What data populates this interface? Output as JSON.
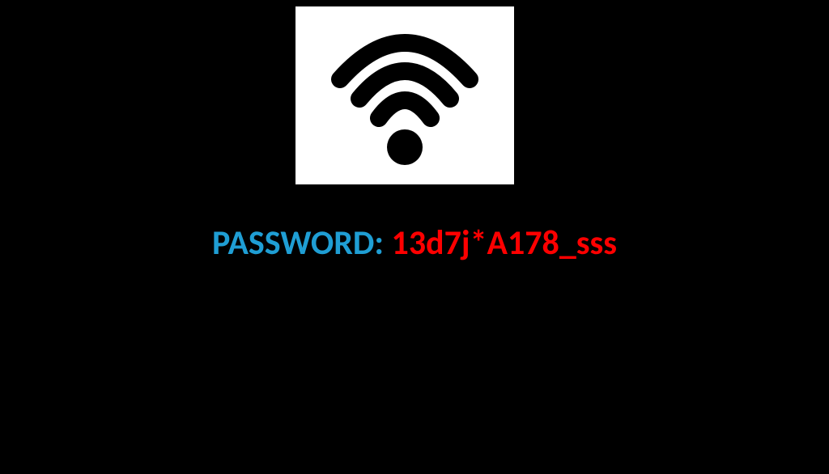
{
  "password": {
    "label": "PASSWORD: ",
    "value": "13d7j*A178_sss"
  }
}
